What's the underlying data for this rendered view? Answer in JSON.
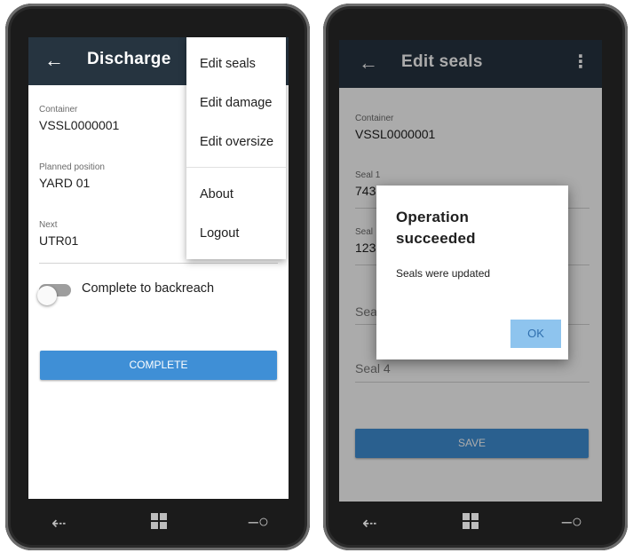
{
  "left_screen": {
    "title": "Discharge",
    "fields": [
      {
        "label": "Container",
        "value": "VSSL0000001"
      },
      {
        "label": "Planned position",
        "value": "YARD 01"
      },
      {
        "label": "Next",
        "value": "UTR01"
      }
    ],
    "toggle": {
      "label": "Complete to backreach",
      "on": false
    },
    "complete_button": "COMPLETE",
    "menu": {
      "items": [
        "Edit seals",
        "Edit damage",
        "Edit oversize",
        "About",
        "Logout"
      ]
    }
  },
  "right_screen": {
    "title": "Edit seals",
    "container": {
      "label": "Container",
      "value": "VSSL0000001"
    },
    "seals": [
      {
        "label": "Seal 1",
        "value": "743"
      },
      {
        "label": "Seal",
        "value": "123"
      },
      {
        "label": "",
        "value": "Sea"
      },
      {
        "label": "",
        "value": "Seal 4"
      }
    ],
    "save_button": "SAVE",
    "dialog": {
      "title": "Operation succeeded",
      "message": "Seals were updated",
      "ok_label": "OK"
    }
  },
  "icons": {
    "back": "arrow-left-icon",
    "more": "more-vertical-icon",
    "nav_back": "windows-back-icon",
    "nav_home": "windows-logo-icon",
    "nav_search": "windows-search-icon"
  },
  "colors": {
    "appbar": "#263440",
    "primary_button": "#3f8fd6",
    "dialog_ok": "#8ec4ee",
    "phone_body": "#1b1b1b"
  }
}
